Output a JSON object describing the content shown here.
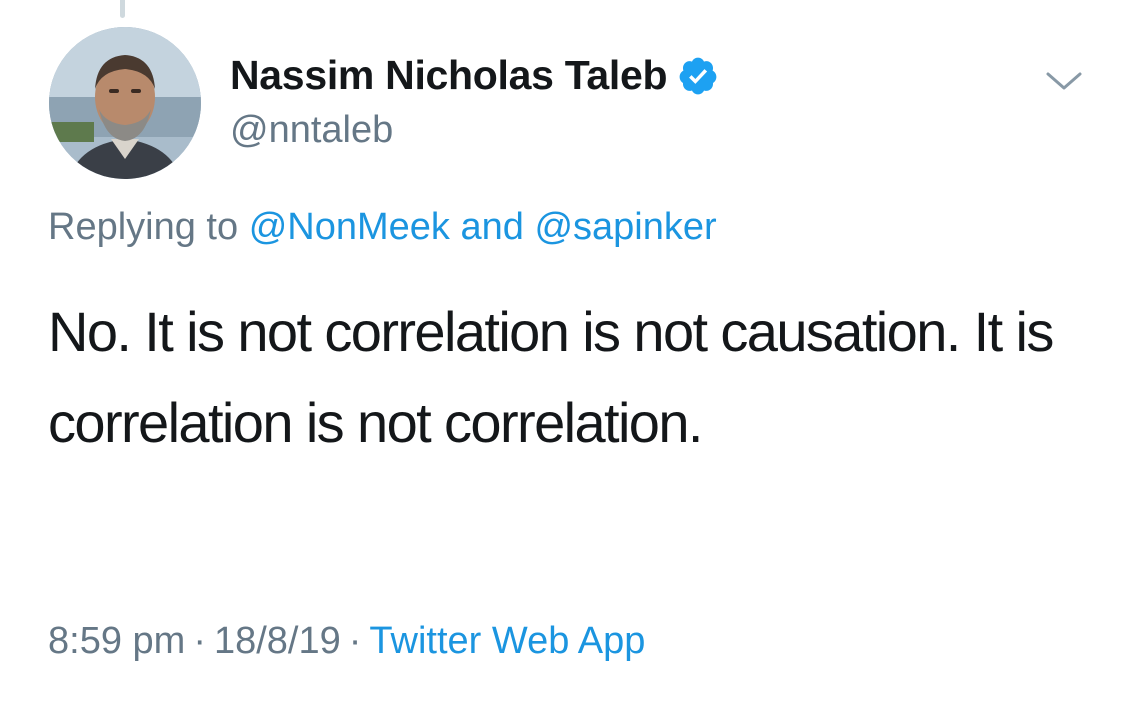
{
  "author": {
    "display_name": "Nassim Nicholas Taleb",
    "handle": "@nntaleb",
    "verified": true
  },
  "reply_context": {
    "prefix": "Replying to",
    "mention_1": "@NonMeek",
    "conjunction": "and",
    "mention_2": "@sapinker"
  },
  "tweet": {
    "text": "No. It is not correlation is not causation. It is correlation is not correlation."
  },
  "meta": {
    "time": "8:59 pm",
    "separator": "·",
    "date": "18/8/19",
    "source": "Twitter Web App"
  },
  "icons": {
    "verified": "verified-badge-icon",
    "menu": "chevron-down-icon"
  },
  "colors": {
    "text_primary": "#14171a",
    "text_secondary": "#657786",
    "link": "#1b95e0",
    "verified": "#1da1f2"
  }
}
